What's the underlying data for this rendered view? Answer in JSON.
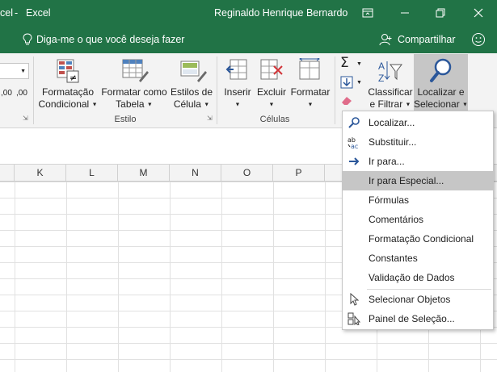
{
  "titlebar": {
    "app_partial": "cel",
    "app_name": "Excel",
    "user": "Reginaldo Henrique Bernardo"
  },
  "tellme": {
    "placeholder": "Diga-me o que você deseja fazer",
    "share": "Compartilhar"
  },
  "ribbon": {
    "numfmt_partial": ",00",
    "conditional": [
      "Formatação",
      "Condicional"
    ],
    "format_table": [
      "Formatar como",
      "Tabela"
    ],
    "cell_styles": [
      "Estilos de",
      "Célula"
    ],
    "group_style": "Estilo",
    "insert": "Inserir",
    "delete": "Excluir",
    "format": "Formatar",
    "group_cells": "Células",
    "sort_filter": [
      "Classificar",
      "e Filtrar"
    ],
    "find_select": [
      "Localizar e",
      "Selecionar"
    ]
  },
  "columns": [
    "K",
    "L",
    "M",
    "N",
    "O",
    "P"
  ],
  "menu": {
    "items": [
      {
        "label": "Localizar...",
        "icon": "magnifier-icon"
      },
      {
        "label": "Substituir...",
        "icon": "replace-ab-ac-icon"
      },
      {
        "label": "Ir para...",
        "icon": "arrow-right-icon"
      },
      {
        "label": "Ir para Especial...",
        "icon": "",
        "highlighted": true
      },
      {
        "label": "Fórmulas",
        "icon": ""
      },
      {
        "label": "Comentários",
        "icon": ""
      },
      {
        "label": "Formatação Condicional",
        "icon": ""
      },
      {
        "label": "Constantes",
        "icon": ""
      },
      {
        "label": "Validação de Dados",
        "icon": ""
      },
      {
        "label": "Selecionar Objetos",
        "icon": "cursor-arrow-icon"
      },
      {
        "label": "Painel de Seleção...",
        "icon": "selection-pane-icon"
      }
    ]
  },
  "colors": {
    "brand": "#217346",
    "ribbon": "#f3f3f3",
    "highlight": "#c6c6c6"
  }
}
